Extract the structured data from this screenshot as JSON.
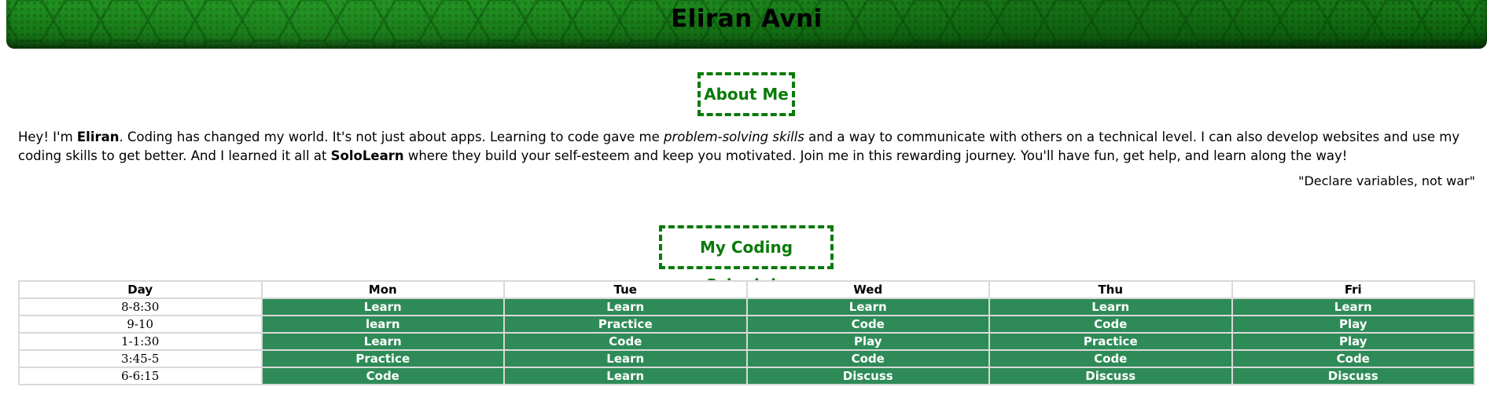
{
  "header": {
    "title": "Eliran Avni"
  },
  "about": {
    "heading": "About Me",
    "p1": "Hey! I'm ",
    "name": "Eliran",
    "p2": ". Coding has changed my world. It's not just about apps. Learning to code gave me ",
    "skills": "problem-solving skills",
    "p3": " and a way to communicate with others on a technical level. I can also develop websites and use my coding skills to get better. And I learned it all at ",
    "site": "SoloLearn",
    "p4": " where they build your self-esteem and keep you motivated. Join me in this rewarding journey. You'll have fun, get help, and learn along the way!",
    "quote": "\"Declare variables, not war\""
  },
  "schedule": {
    "heading": "My Coding Schedule",
    "headers": [
      "Day",
      "Mon",
      "Tue",
      "Wed",
      "Thu",
      "Fri"
    ],
    "rows": [
      {
        "time": "8-8:30",
        "cells": [
          "Learn",
          "Learn",
          "Learn",
          "Learn",
          "Learn"
        ]
      },
      {
        "time": "9-10",
        "cells": [
          "learn",
          "Practice",
          "Code",
          "Code",
          "Play"
        ]
      },
      {
        "time": "1-1:30",
        "cells": [
          "Learn",
          "Code",
          "Play",
          "Practice",
          "Play"
        ]
      },
      {
        "time": "3:45-5",
        "cells": [
          "Practice",
          "Learn",
          "Code",
          "Code",
          "Code"
        ]
      },
      {
        "time": "6-6:15",
        "cells": [
          "Code",
          "Learn",
          "Discuss",
          "Discuss",
          "Discuss"
        ]
      }
    ]
  },
  "colors": {
    "accent": "#0a7a0a",
    "cell_bg": "#2e8b57",
    "header_green": "#0c7a0c"
  }
}
